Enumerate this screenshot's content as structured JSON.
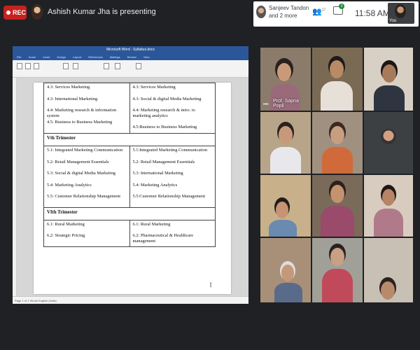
{
  "meeting": {
    "rec_label": "REC",
    "presenting_text": "Ashish Kumar Jha is presenting",
    "participants_names_line1": "Sanjeev Tandon",
    "participants_names_line2": "and 2 more",
    "participant_count": "17",
    "chat_badge": "3",
    "time": "11:58 AM",
    "self_label": "You"
  },
  "word": {
    "title": "Microsoft Word - Syllabus.docx",
    "tabs": [
      "File",
      "Home",
      "Insert",
      "Design",
      "Layout",
      "References",
      "Mailings",
      "Review",
      "View"
    ],
    "status": "Page 1 of 1   Words   English (India)"
  },
  "document": {
    "left_top": [
      "4.3: Services Marketing",
      "4.3: International Marketing",
      "4.4: Marketing research & information system",
      "4.5: Business to Business Marketing"
    ],
    "right_top": [
      "4.3: Services Marketing",
      "4.3: Social & digital Media Marketing",
      "4.4: Marketing research & intro. to marketing analytics",
      "4.5:Business to Business Marketing"
    ],
    "section_v": "Vth Trimester",
    "left_mid": [
      "5.1: Integrated Marketing Communication",
      "5.2: Retail Management Essentials",
      "5.3: Social & digital Media Marketing",
      "5.4: Marketing Analytics",
      "5.5: Customer Relationship Management"
    ],
    "right_mid": [
      "5.1:Integrated Marketing Communication",
      "5.2: Retail Management Essentials",
      "5.3: International Marketing",
      "5.4: Marketing Analytics",
      "5.5:Customer Relationship Management"
    ],
    "section_vi": "VIth Trimester",
    "left_bottom": [
      "6.1: Rural Marketing",
      "6.2: Strategic Pricing"
    ],
    "right_bottom": [
      "6.1: Rural Marketing",
      "6.2: Pharmaceutical & Healthcare management"
    ]
  },
  "tiles": {
    "sapna_label": "Prof. Sapna Popli"
  }
}
